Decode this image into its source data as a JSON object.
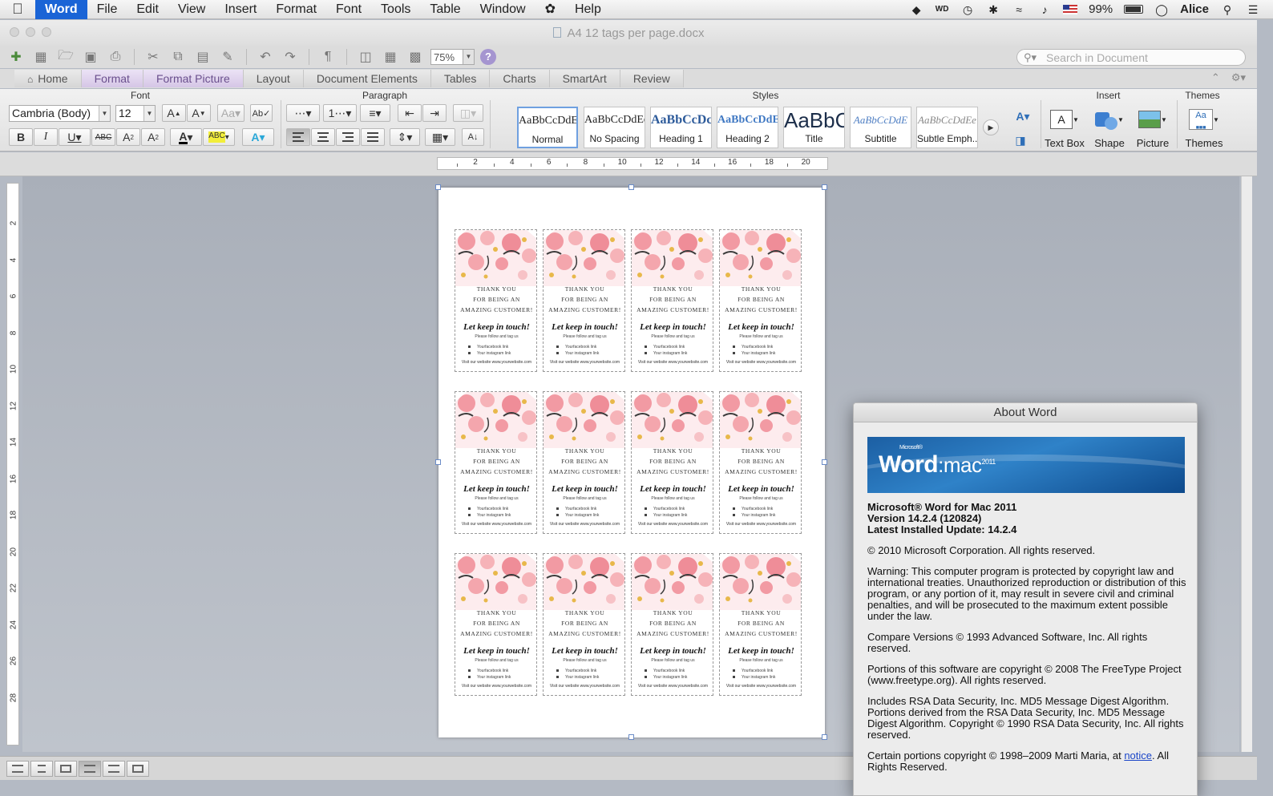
{
  "menubar": {
    "app_name": "Word",
    "items": [
      "File",
      "Edit",
      "View",
      "Insert",
      "Format",
      "Font",
      "Tools",
      "Table",
      "Window",
      "Help"
    ],
    "battery": "99%",
    "user": "Alice"
  },
  "window": {
    "title": "A4 12 tags per page.docx"
  },
  "toolbar": {
    "zoom": "75%",
    "search_placeholder": "Search in Document"
  },
  "ribbon_tabs": [
    {
      "label": "Home"
    },
    {
      "label": "Format"
    },
    {
      "label": "Format Picture"
    },
    {
      "label": "Layout"
    },
    {
      "label": "Document Elements"
    },
    {
      "label": "Tables"
    },
    {
      "label": "Charts"
    },
    {
      "label": "SmartArt"
    },
    {
      "label": "Review"
    }
  ],
  "ribbon": {
    "group_font": "Font",
    "group_paragraph": "Paragraph",
    "group_styles": "Styles",
    "group_insert": "Insert",
    "group_themes": "Themes",
    "font_name": "Cambria (Body)",
    "font_size": "12",
    "styles": [
      {
        "sample": "AaBbCcDdEe",
        "name": "Normal"
      },
      {
        "sample": "AaBbCcDdEe",
        "name": "No Spacing"
      },
      {
        "sample": "AaBbCcDc",
        "name": "Heading 1"
      },
      {
        "sample": "AaBbCcDdEe",
        "name": "Heading 2"
      },
      {
        "sample": "AaBbC",
        "name": "Title"
      },
      {
        "sample": "AaBbCcDdE",
        "name": "Subtitle"
      },
      {
        "sample": "AaBbCcDdEe",
        "name": "Subtle Emph..."
      }
    ],
    "insert_items": [
      "Text Box",
      "Shape",
      "Picture"
    ],
    "themes_label": "Themes"
  },
  "ruler_h": [
    "2",
    "4",
    "6",
    "8",
    "10",
    "12",
    "14",
    "16",
    "18",
    "20"
  ],
  "ruler_v": [
    "2",
    "4",
    "6",
    "8",
    "10",
    "12",
    "14",
    "16",
    "18",
    "20",
    "22",
    "24",
    "26",
    "28"
  ],
  "tag": {
    "line1": "THANK YOU",
    "line2": "FOR BEING AN",
    "line3": "AMAZING CUSTOMER!",
    "script": "Let keep in touch!",
    "small": "Please follow and tag us",
    "facebook": "Yourfacebook link",
    "instagram": "Your instagram link",
    "site": "Visit our website www.yourwebsite.com"
  },
  "about": {
    "title": "About Word",
    "banner_ms": "Microsoft®",
    "banner_word": "Word",
    "banner_mac": ":mac",
    "banner_year": "2011",
    "product": "Microsoft® Word for Mac 2011",
    "version": "Version 14.2.4 (120824)",
    "update": "Latest Installed Update: 14.2.4",
    "copyright": "© 2010 Microsoft Corporation. All rights reserved.",
    "warning": "Warning: This computer program is protected by copyright law and international treaties.  Unauthorized reproduction or distribution of this program, or any portion of it, may result in severe civil and criminal penalties, and will be prosecuted to the maximum extent possible under the law.",
    "compare": "Compare Versions © 1993 Advanced Software, Inc.  All rights reserved.",
    "freetype": "Portions of this software are copyright © 2008 The FreeType Project (www.freetype.org).  All rights reserved.",
    "rsa": "Includes RSA Data Security, Inc. MD5 Message Digest Algorithm. Portions derived from the RSA Data Security, Inc. MD5 Message Digest Algorithm.  Copyright © 1990 RSA Data Security, Inc. All rights reserved.",
    "certain_pre": "Certain portions copyright © 1998–2009  Marti Maria, at",
    "certain_link": "notice",
    "certain_post": ".  All Rights Reserved."
  }
}
